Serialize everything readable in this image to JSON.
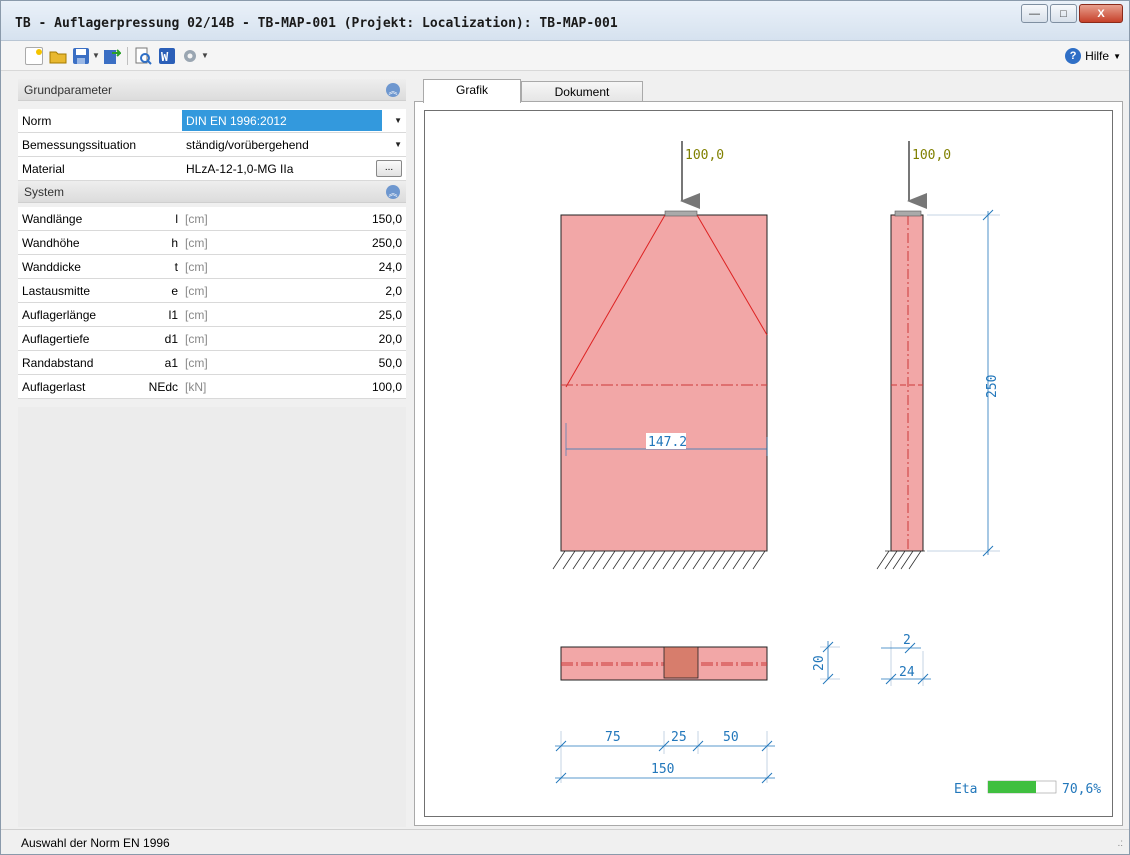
{
  "window": {
    "title": "TB - Auflagerpressung  02/14B - TB-MAP-001 (Projekt: Localization): TB-MAP-001",
    "minimize": "—",
    "maximize": "□",
    "close": "X"
  },
  "toolbar": {
    "icons": [
      "new-icon",
      "open-icon",
      "save-icon",
      "export-icon",
      "print-preview-icon",
      "word-icon",
      "settings-icon"
    ],
    "help_label": "Hilfe",
    "help_icon": "?"
  },
  "grundparameter": {
    "heading": "Grundparameter",
    "rows": [
      {
        "label": "Norm",
        "value": "DIN EN 1996:2012"
      },
      {
        "label": "Bemessungssituation",
        "value": "ständig/vorübergehend"
      },
      {
        "label": "Material",
        "value": "HLzA-12-1,0-MG IIa",
        "button": "..."
      }
    ]
  },
  "system": {
    "heading": "System",
    "rows": [
      {
        "label": "Wandlänge",
        "symbol": "l",
        "unit": "[cm]",
        "value": "150,0"
      },
      {
        "label": "Wandhöhe",
        "symbol": "h",
        "unit": "[cm]",
        "value": "250,0"
      },
      {
        "label": "Wanddicke",
        "symbol": "t",
        "unit": "[cm]",
        "value": "24,0"
      },
      {
        "label": "Lastausmitte",
        "symbol": "e",
        "unit": "[cm]",
        "value": "2,0"
      },
      {
        "label": "Auflagerlänge",
        "symbol": "l1",
        "unit": "[cm]",
        "value": "25,0"
      },
      {
        "label": "Auflagertiefe",
        "symbol": "d1",
        "unit": "[cm]",
        "value": "20,0"
      },
      {
        "label": "Randabstand",
        "symbol": "a1",
        "unit": "[cm]",
        "value": "50,0"
      },
      {
        "label": "Auflagerlast",
        "symbol": "NEdc",
        "unit": "[kN]",
        "value": "100,0"
      }
    ]
  },
  "tabs": [
    {
      "label": "Grafik",
      "active": true
    },
    {
      "label": "Dokument",
      "active": false
    }
  ],
  "graphic": {
    "load_front": "100,0",
    "load_side": "100,0",
    "spread_width": "147.2",
    "height_dim": "250",
    "plan_depth_dim": "20",
    "eccentricity_dim": "2",
    "thickness_dim": "24",
    "dim_left": "75",
    "dim_support": "25",
    "dim_right": "50",
    "dim_total": "150",
    "eta_label": "Eta",
    "eta_value": "70,6%",
    "eta_fraction": 0.706,
    "colors": {
      "wall_fill": "#f2a7a7",
      "wall_edge": "#cc3a3a",
      "dim": "#2277bb",
      "load_text": "#808000",
      "eta_bar": "#3fbf3f"
    }
  },
  "status": {
    "message": "Auswahl der Norm EN 1996"
  }
}
